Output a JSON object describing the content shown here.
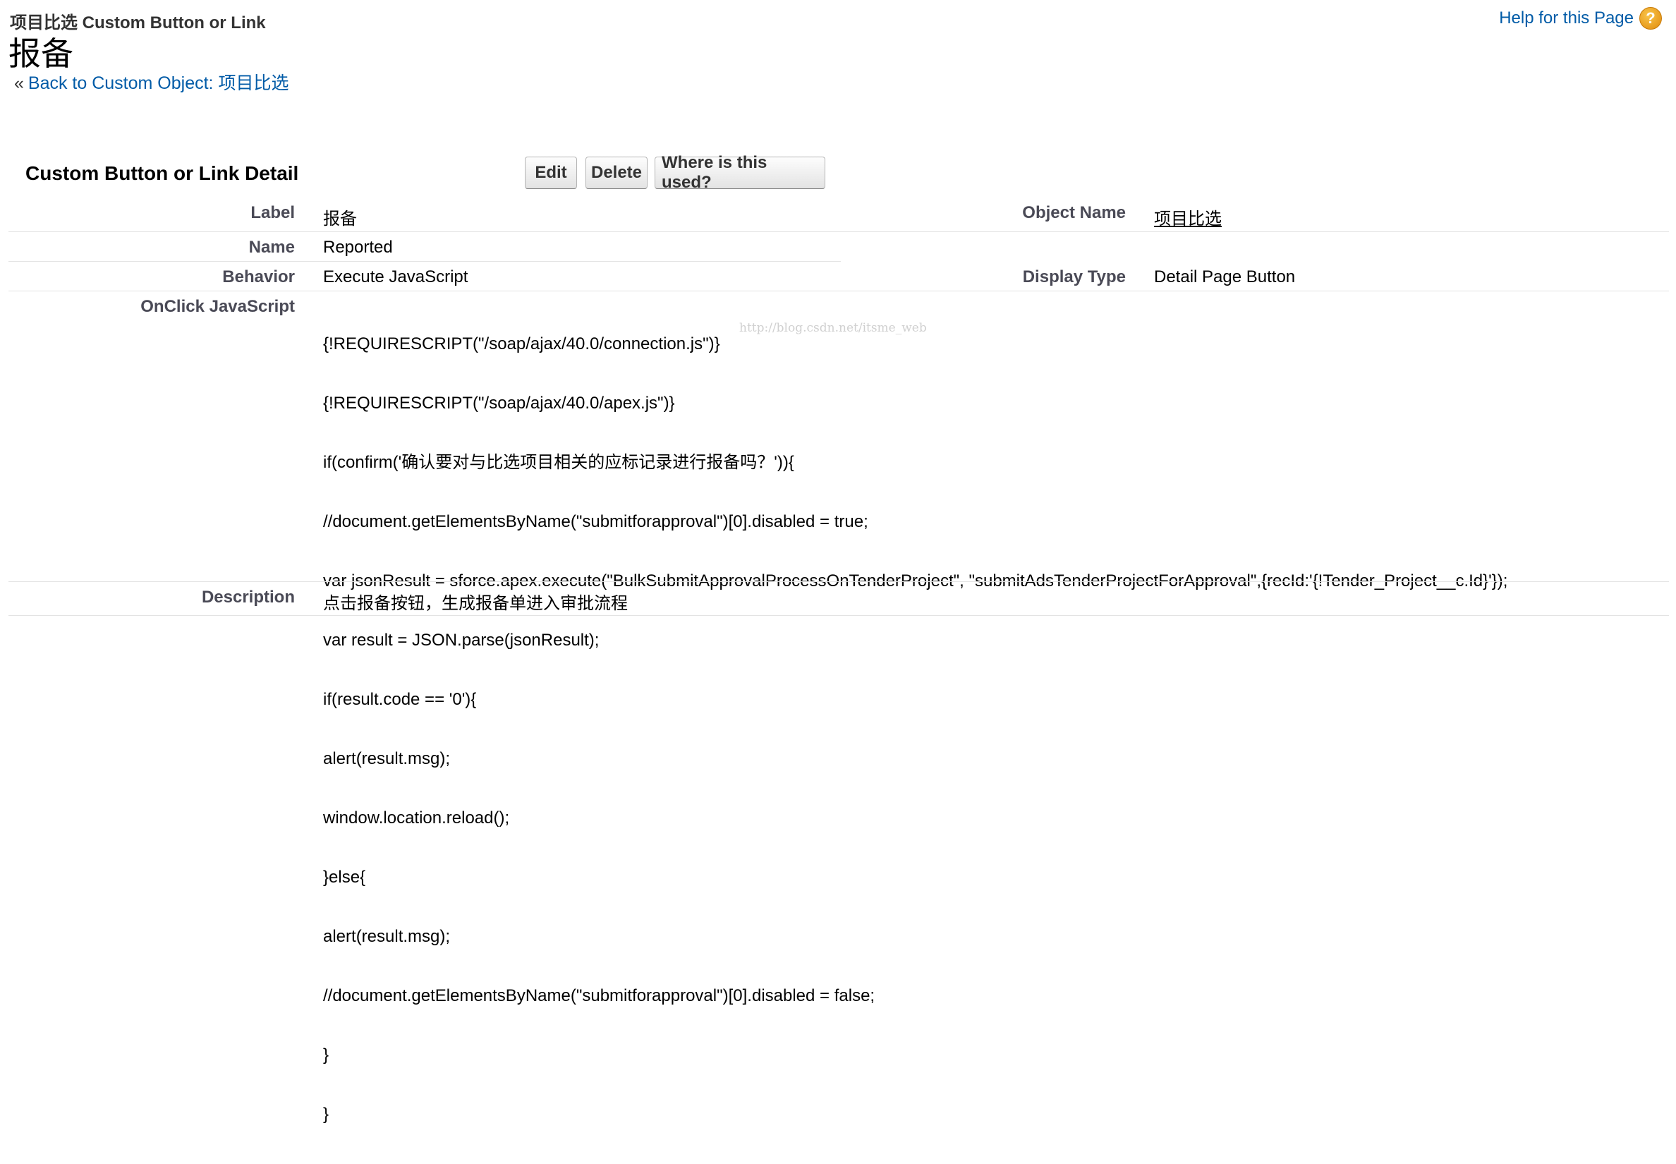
{
  "header": {
    "object_breadcrumb": "项目比选 Custom Button or Link",
    "page_title": "报备",
    "back_arrow": "«",
    "back_link": "Back to Custom Object: 项目比选",
    "help_link": "Help for this Page",
    "help_icon": "?"
  },
  "detail": {
    "section_title": "Custom Button or Link Detail",
    "buttons": {
      "edit": "Edit",
      "delete": "Delete",
      "where_used": "Where is this used?"
    },
    "fields": {
      "label_label": "Label",
      "label_value": "报备",
      "object_name_label": "Object Name",
      "object_name_value": "项目比选",
      "name_label": "Name",
      "name_value": "Reported",
      "behavior_label": "Behavior",
      "behavior_value": "Execute JavaScript",
      "display_type_label": "Display Type",
      "display_type_value": "Detail Page Button",
      "onclick_label": "OnClick JavaScript",
      "description_label": "Description",
      "description_value": "点击报备按钮，生成报备单进入审批流程"
    },
    "code_lines": [
      "{!REQUIRESCRIPT(\"/soap/ajax/40.0/connection.js\")}",
      "{!REQUIRESCRIPT(\"/soap/ajax/40.0/apex.js\")}",
      "if(confirm('确认要对与比选项目相关的应标记录进行报备吗？')){",
      "//document.getElementsByName(\"submitforapproval\")[0].disabled = true;",
      "var jsonResult = sforce.apex.execute(\"BulkSubmitApprovalProcessOnTenderProject\", \"submitAdsTenderProjectForApproval\",{recId:'{!Tender_Project__c.Id}'});",
      "var result = JSON.parse(jsonResult);",
      "if(result.code == '0'){",
      "alert(result.msg);",
      "window.location.reload();",
      "}else{",
      "alert(result.msg);",
      "//document.getElementsByName(\"submitforapproval\")[0].disabled = false;",
      "}",
      "}"
    ],
    "watermark": "http://blog.csdn.net/itsme_web"
  },
  "colors": {
    "link": "#015ba7",
    "label": "#4a4a56",
    "divider": "#e3e3e3"
  }
}
